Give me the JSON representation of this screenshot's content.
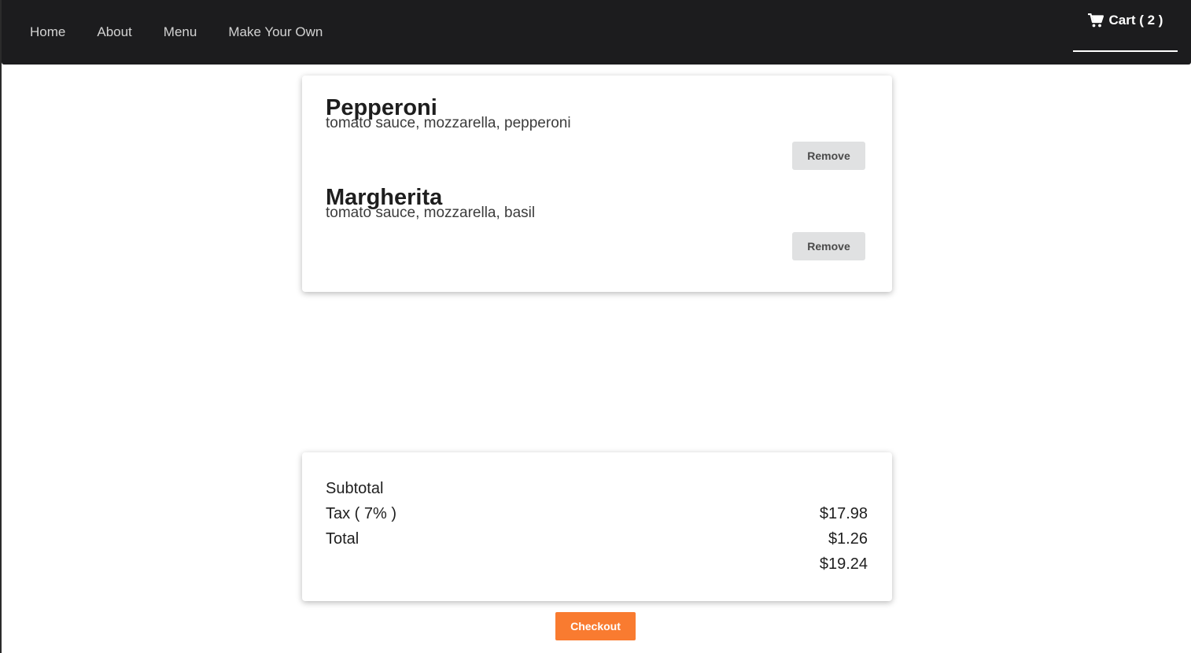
{
  "nav": {
    "links": [
      {
        "label": "Home"
      },
      {
        "label": "About"
      },
      {
        "label": "Menu"
      },
      {
        "label": "Make Your Own"
      }
    ],
    "cart_label": "Cart ( 2 )",
    "cart_icon": "shopping-cart-icon"
  },
  "cart": {
    "items": [
      {
        "name": "Pepperoni",
        "description": "tomato sauce, mozzarella, pepperoni",
        "remove_label": "Remove"
      },
      {
        "name": "Margherita",
        "description": "tomato sauce, mozzarella, basil",
        "remove_label": "Remove"
      }
    ]
  },
  "summary": {
    "labels": [
      "Subtotal",
      "Tax ( 7% )",
      "Total"
    ],
    "values": [
      "$17.98",
      "$1.26",
      "$19.24"
    ]
  },
  "checkout_label": "Checkout",
  "colors": {
    "navbar_bg": "#1c1c1e",
    "checkout_accent": "#f97b30",
    "remove_button_bg": "#e0e1e2"
  }
}
